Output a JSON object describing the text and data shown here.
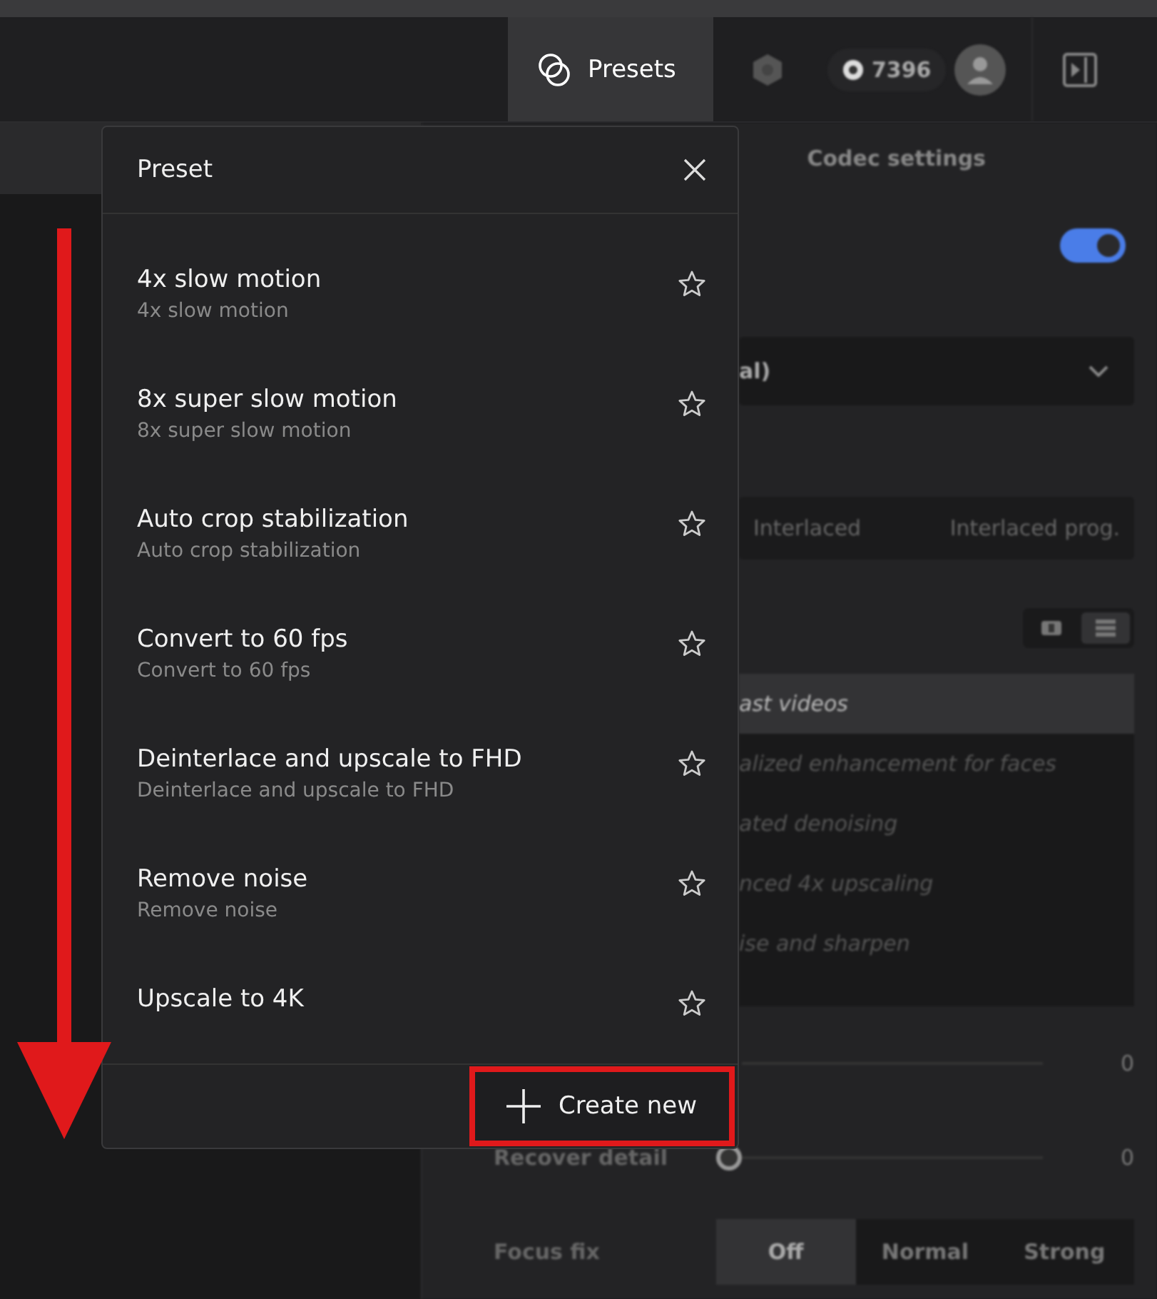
{
  "header": {
    "presets_button": {
      "label": "Presets",
      "selected": true
    },
    "credits": "7396"
  },
  "panel": {
    "tab": "Codec settings",
    "toggle": {
      "on": true
    },
    "dropdown_value": "al)",
    "scan_options": [
      {
        "label": "Interlaced",
        "selected": false
      },
      {
        "label": "Interlaced prog.",
        "selected": false
      }
    ],
    "view_modes": [
      {
        "kind": "grid",
        "selected": false
      },
      {
        "kind": "list",
        "selected": true
      }
    ],
    "models": [
      {
        "label": "ast videos",
        "selected": true
      },
      {
        "label": "alized enhancement for faces",
        "selected": false
      },
      {
        "label": "ated denoising",
        "selected": false
      },
      {
        "label": "nced 4x upscaling",
        "selected": false
      },
      {
        "label": "ise and sharpen",
        "selected": false
      }
    ],
    "sliders": [
      {
        "value": "0"
      },
      {
        "label": "Recover detail",
        "value": "0",
        "level": 0
      }
    ],
    "focus_fix": {
      "label": "Focus fix",
      "options": [
        {
          "label": "Off",
          "selected": true
        },
        {
          "label": "Normal",
          "selected": false
        },
        {
          "label": "Strong",
          "selected": false
        }
      ]
    }
  },
  "popup": {
    "title": "Preset",
    "presets": [
      {
        "name": "4x slow motion",
        "description": "4x slow motion",
        "favorite": false
      },
      {
        "name": "8x super slow motion",
        "description": "8x super slow motion",
        "favorite": false
      },
      {
        "name": "Auto crop stabilization",
        "description": "Auto crop stabilization",
        "favorite": false
      },
      {
        "name": "Convert to 60 fps",
        "description": "Convert to 60 fps",
        "favorite": false
      },
      {
        "name": "Deinterlace and upscale to FHD",
        "description": "Deinterlace and upscale to FHD",
        "favorite": false
      },
      {
        "name": "Remove noise",
        "description": "Remove noise",
        "favorite": false
      },
      {
        "name": "Upscale to 4K",
        "favorite": false
      }
    ],
    "create_button": {
      "label": "Create new",
      "highlighted": true
    }
  },
  "annotations": [
    {
      "kind": "down-arrow"
    }
  ]
}
